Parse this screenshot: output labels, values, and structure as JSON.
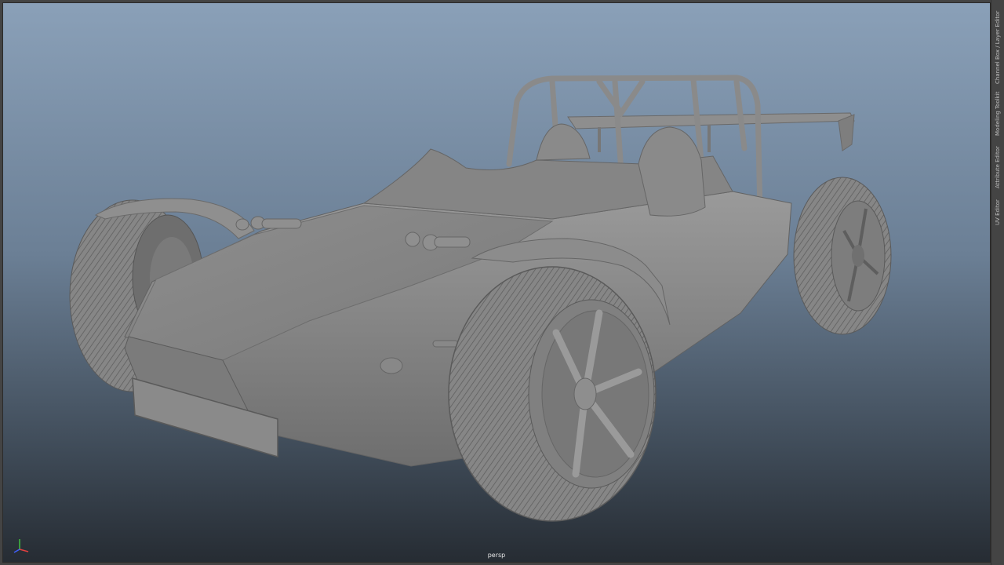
{
  "viewport": {
    "camera_label": "persp",
    "background_top": "#8aa0b8",
    "background_bottom": "#262c33",
    "model": {
      "name": "sports-roadster-model",
      "shading_color": "#8c8c8c"
    },
    "axis_gizmo": {
      "x_color": "#e04040",
      "y_color": "#40c040",
      "z_color": "#4060ff"
    }
  },
  "side_panel": {
    "tabs": [
      {
        "label": "Channel Box / Layer Editor"
      },
      {
        "label": "Modeling Toolkit"
      },
      {
        "label": "Attribute Editor"
      },
      {
        "label": "UV Editor"
      }
    ]
  }
}
